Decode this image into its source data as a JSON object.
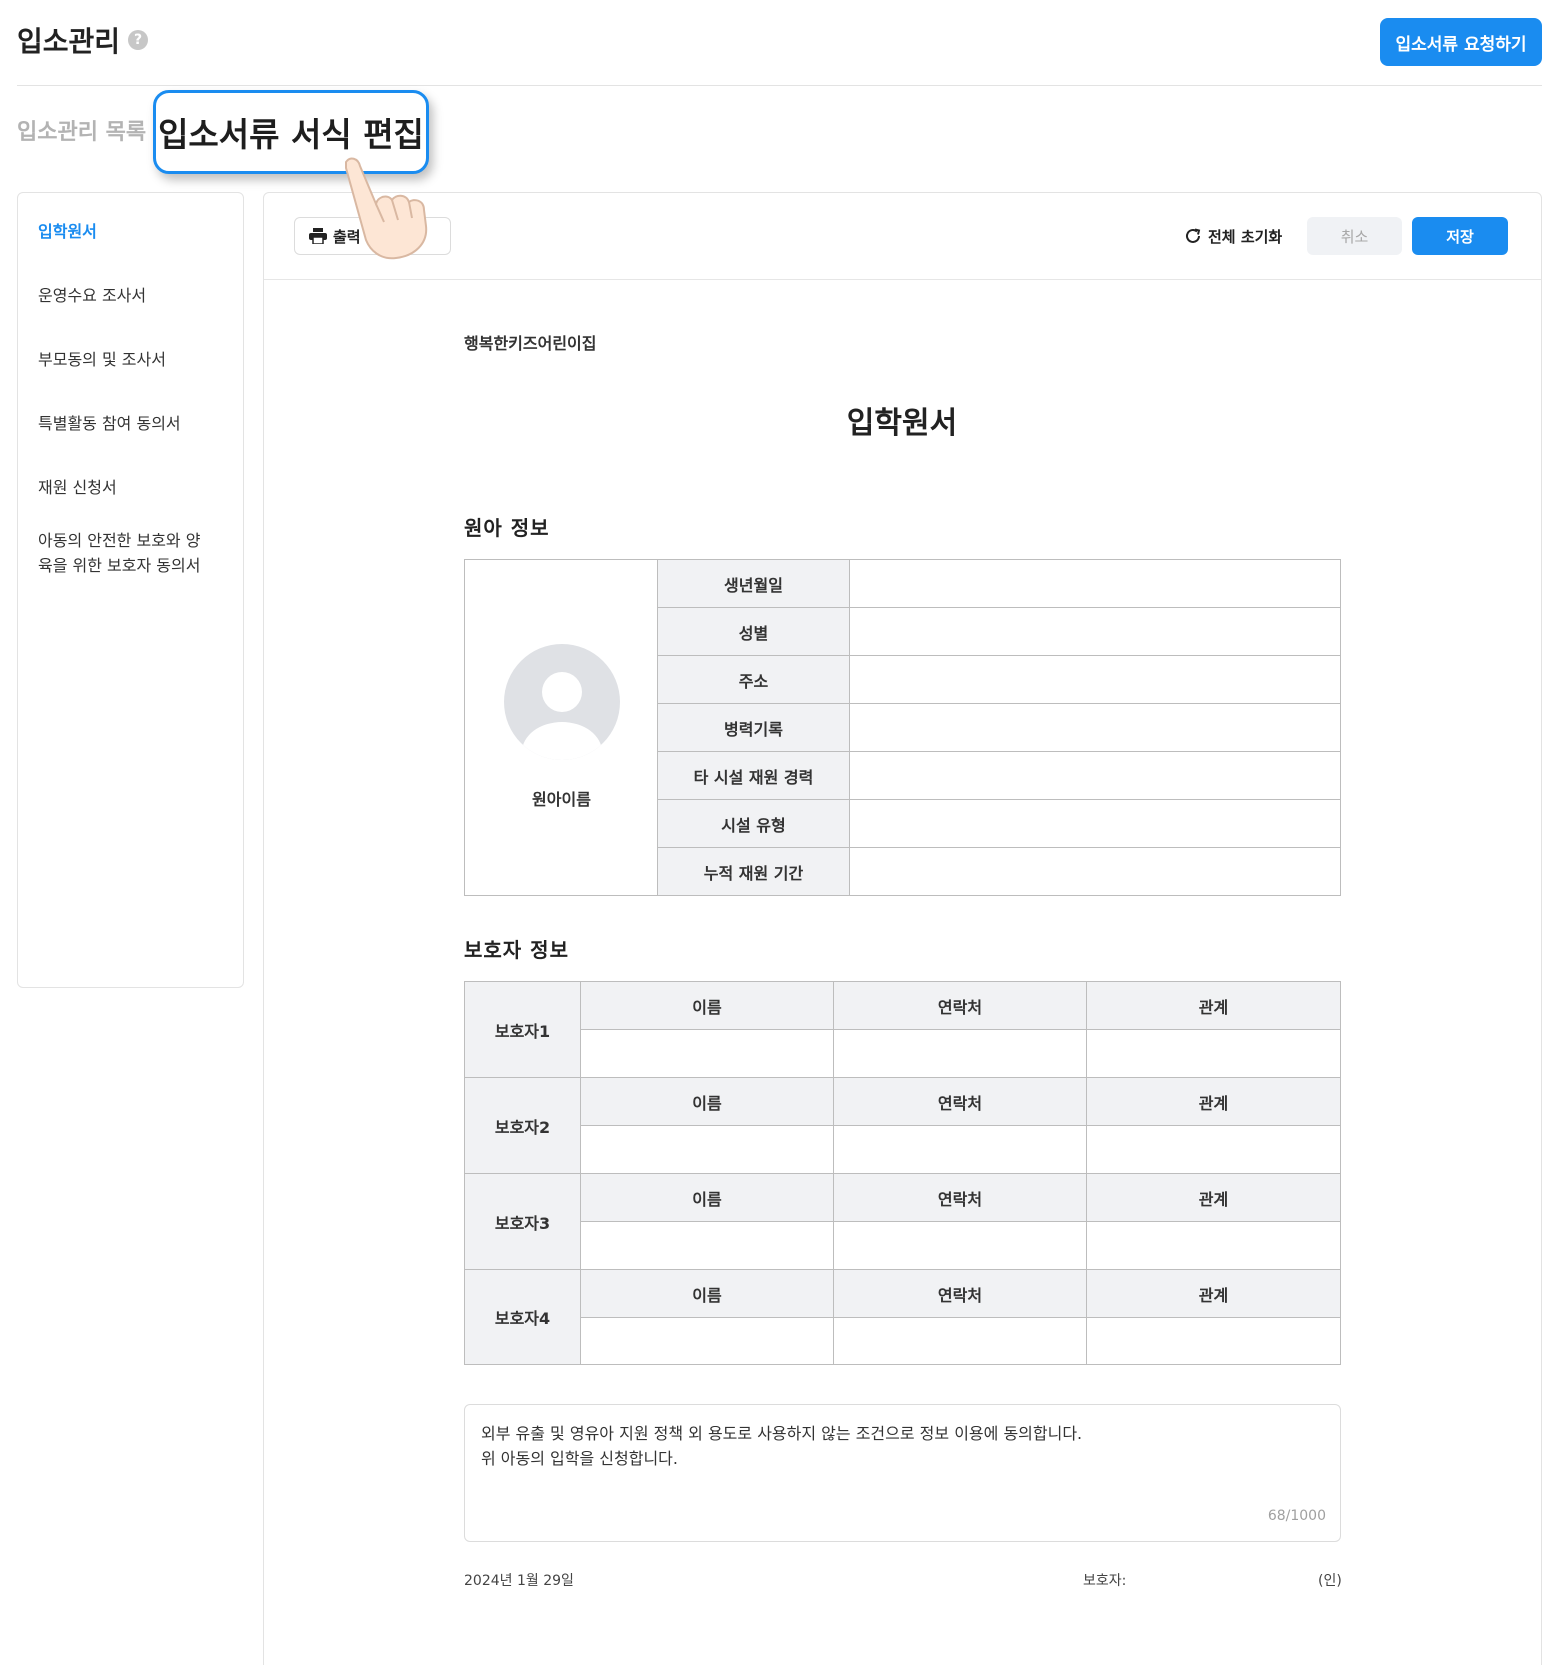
{
  "header": {
    "title": "입소관리",
    "help_icon": "?",
    "request_button": "입소서류 요청하기"
  },
  "tabs": {
    "list_label": "입소관리 목록",
    "active_label": "입소서류 서식 편집"
  },
  "sidebar": {
    "items": [
      {
        "label": "입학원서",
        "active": true
      },
      {
        "label": "운영수요 조사서"
      },
      {
        "label": "부모동의 및 조사서"
      },
      {
        "label": "특별활동 참여 동의서"
      },
      {
        "label": "재원 신청서"
      },
      {
        "label": "아동의 안전한 보호와 양육을 위한 보호자 동의서"
      }
    ]
  },
  "toolbar": {
    "print_label": "출력",
    "print_icon": "printer-icon",
    "reset_label": "전체 초기화",
    "reset_icon": "refresh-icon",
    "cancel_label": "취소",
    "save_label": "저장"
  },
  "document": {
    "org_name": "행복한키즈어린이집",
    "title": "입학원서",
    "child_section": {
      "title": "원아 정보",
      "child_name": "원아이름",
      "fields": [
        "생년월일",
        "성별",
        "주소",
        "병력기록",
        "타 시설 재원 경력",
        "시설 유형",
        "누적 재원 기간"
      ]
    },
    "guardian_section": {
      "title": "보호자 정보",
      "columns": [
        "이름",
        "연락처",
        "관계"
      ],
      "guardians": [
        "보호자1",
        "보호자2",
        "보호자3",
        "보호자4"
      ]
    },
    "consent": {
      "line1": "외부 유출 및 영유아 지원 정책 외 용도로 사용하지 않는 조건으로 정보 이용에 동의합니다.",
      "line2": "위 아동의 입학을 신청합니다.",
      "counter": "68/1000"
    },
    "footer": {
      "date": "2024년 1월 29일",
      "guardian_label": "보호자:",
      "seal": "(인)"
    }
  },
  "colors": {
    "accent": "#1a8cf0",
    "header_cell": "#f1f2f4",
    "border": "#bdbdbd"
  }
}
